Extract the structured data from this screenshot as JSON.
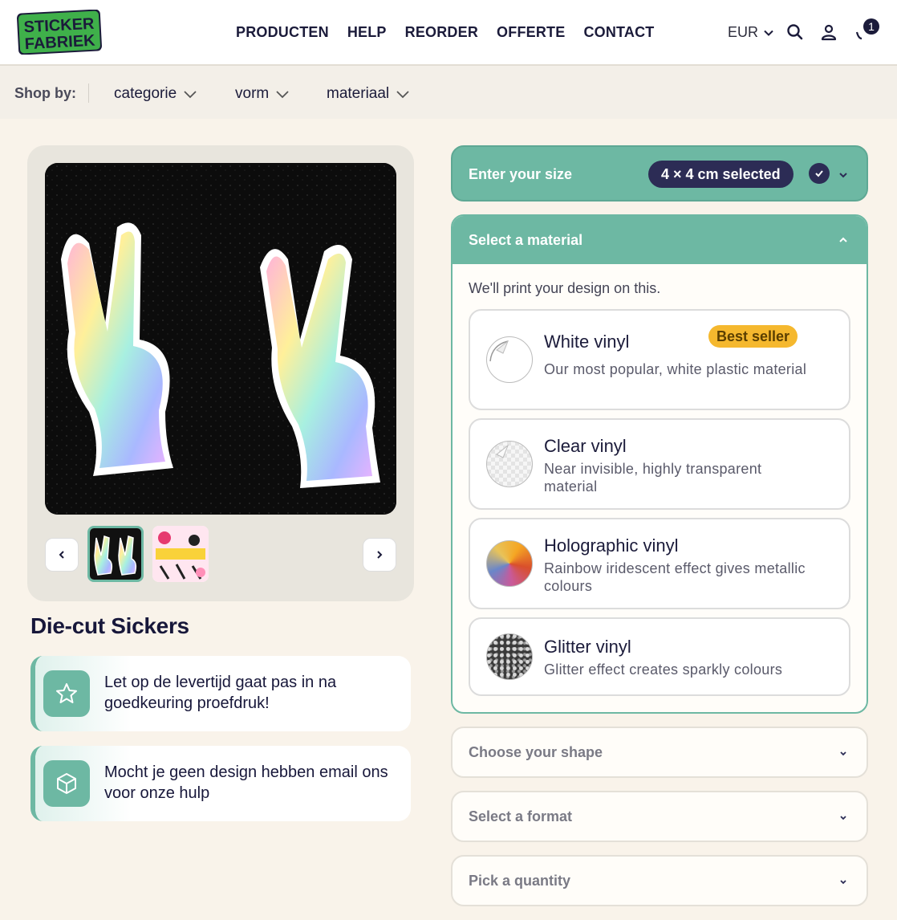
{
  "brand": {
    "logo_line1": "STICKER",
    "logo_line2": "FABRIEK"
  },
  "nav": {
    "items": [
      "PRODUCTEN",
      "HELP",
      "REORDER",
      "OFFERTE",
      "CONTACT"
    ]
  },
  "header": {
    "currency": "EUR",
    "cart_count": "1"
  },
  "shopby": {
    "label": "Shop by:",
    "filters": [
      "categorie",
      "vorm",
      "materiaal"
    ]
  },
  "product": {
    "title": "Die-cut Sickers"
  },
  "notices": [
    {
      "text": "Let op de levertijd gaat pas in na goedkeuring proefdruk!",
      "icon": "star-icon"
    },
    {
      "text": "Mocht je geen design hebben email ons voor onze hulp",
      "icon": "box-icon"
    }
  ],
  "size": {
    "title": "Enter your size",
    "selected": "4 × 4 cm selected"
  },
  "material": {
    "title": "Select a material",
    "subtitle": "We'll print your design on this.",
    "options": [
      {
        "title": "White vinyl",
        "desc": "Our most popular, white plastic material",
        "badge": "Best seller"
      },
      {
        "title": "Clear vinyl",
        "desc": "Near invisible, highly transparent material"
      },
      {
        "title": "Holographic vinyl",
        "desc": "Rainbow iridescent effect gives metallic colours"
      },
      {
        "title": "Glitter vinyl",
        "desc": "Glitter effect creates sparkly colours"
      }
    ]
  },
  "steps": {
    "shape": "Choose your shape",
    "format": "Select a format",
    "quantity": "Pick a quantity"
  },
  "colors": {
    "accent": "#6db8a3",
    "navy": "#2c2c55",
    "badge": "#f5b82e",
    "brand_green": "#3fb04a"
  }
}
